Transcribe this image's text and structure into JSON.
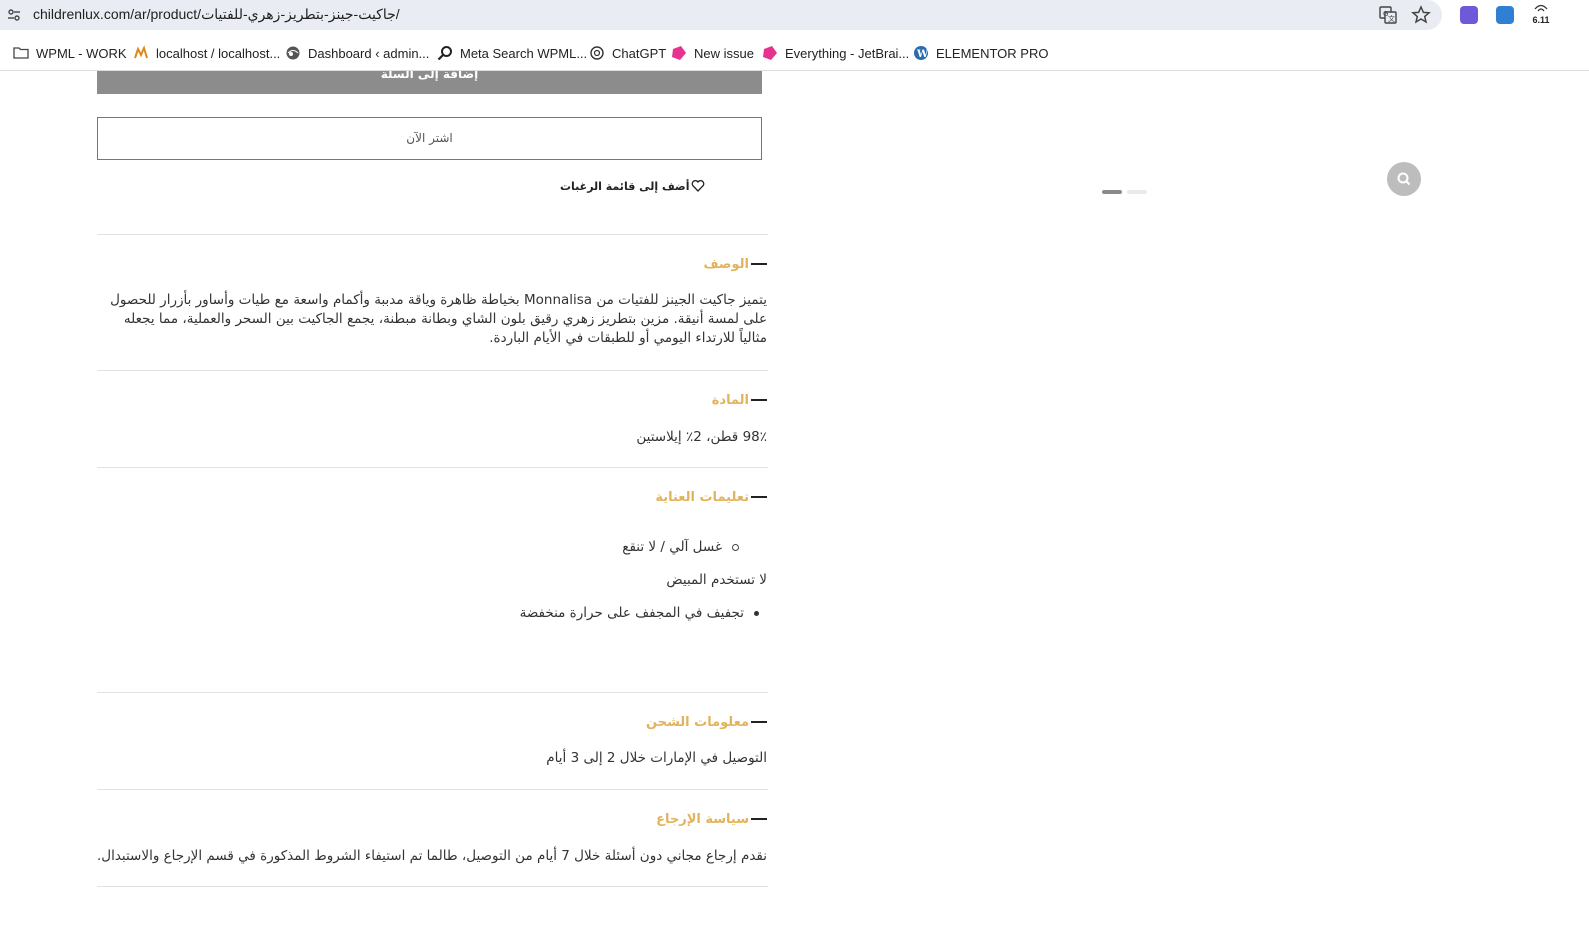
{
  "browser": {
    "url": "childrenlux.com/ar/product/جاكيت-جينز-بتطريز-زهري-للفتيات/",
    "extension_badge": "6.11",
    "bookmarks": [
      {
        "label": "WPML - WORK",
        "icon": "folder-icon"
      },
      {
        "label": "localhost / localhost...",
        "icon": "phpmyadmin-icon"
      },
      {
        "label": "Dashboard ‹ admin...",
        "icon": "globe-icon"
      },
      {
        "label": "Meta Search WPML...",
        "icon": "search-icon"
      },
      {
        "label": "ChatGPT",
        "icon": "openai-icon"
      },
      {
        "label": "New issue",
        "icon": "jetbrains-icon"
      },
      {
        "label": "Everything - JetBrai...",
        "icon": "jetbrains-icon"
      },
      {
        "label": "ELEMENTOR PRO",
        "icon": "wordpress-icon"
      }
    ]
  },
  "product": {
    "add_to_cart": "إضافة إلى السلة",
    "buy_now": "اشتر الآن",
    "wishlist": "أضف إلى قائمة الرغبات"
  },
  "sections": {
    "description": {
      "title": "الوصف",
      "text": "يتميز جاكيت الجينز للفتيات من Monnalisa بخياطة ظاهرة وياقة مدببة وأكمام واسعة مع طيات وأساور بأزرار للحصول على لمسة أنيقة. مزين بتطريز زهري رقيق بلون الشاي وبطانة مبطنة، يجمع الجاكيت بين السحر والعملية، مما يجعله مثالياً للارتداء اليومي أو للطبقات في الأيام الباردة."
    },
    "material": {
      "title": "المادة",
      "text": "98٪ قطن، 2٪ إيلاستين"
    },
    "care": {
      "title": "تعليمات العناية",
      "item1": "غسل آلي / لا تنقع",
      "item2": "لا تستخدم المبيض",
      "item3": "تجفيف في المجفف على حرارة منخفضة"
    },
    "shipping": {
      "title": "معلومات الشحن",
      "text": "التوصيل في الإمارات خلال 2 إلى 3 أيام"
    },
    "returns": {
      "title": "سياسة الإرجاع",
      "text": "نقدم إرجاع مجاني دون أسئلة خلال 7 أيام من التوصيل، طالما تم استيفاء الشروط المذكورة في قسم الإرجاع والاستبدال."
    }
  },
  "colors": {
    "accent": "#e2b35a",
    "button_gray": "#8c8c8c"
  }
}
